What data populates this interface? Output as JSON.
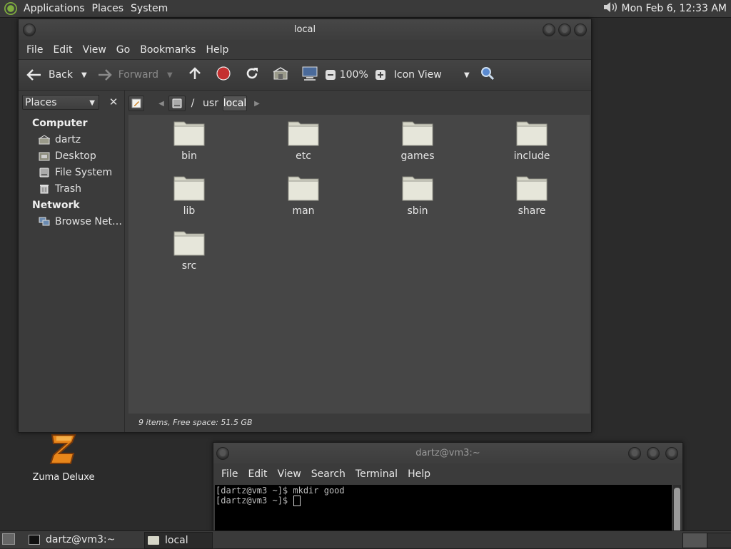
{
  "top_panel": {
    "menus": [
      "Applications",
      "Places",
      "System"
    ],
    "clock": "Mon Feb  6, 12:33 AM"
  },
  "file_manager": {
    "title": "local",
    "menu": [
      "File",
      "Edit",
      "View",
      "Go",
      "Bookmarks",
      "Help"
    ],
    "toolbar": {
      "back": "Back",
      "forward": "Forward",
      "zoom": "100%",
      "view_mode": "Icon View"
    },
    "sidebar": {
      "select": "Places",
      "sections": [
        {
          "heading": "Computer",
          "items": [
            {
              "label": "dartz",
              "icon": "home-icon"
            },
            {
              "label": "Desktop",
              "icon": "desktop-icon"
            },
            {
              "label": "File System",
              "icon": "drive-icon"
            },
            {
              "label": "Trash",
              "icon": "trash-icon"
            }
          ]
        },
        {
          "heading": "Network",
          "items": [
            {
              "label": "Browse Net…",
              "icon": "network-icon"
            }
          ]
        }
      ]
    },
    "path": [
      "/",
      "usr",
      "local"
    ],
    "folders": [
      "bin",
      "etc",
      "games",
      "include",
      "lib",
      "man",
      "sbin",
      "share",
      "src"
    ],
    "status": "9 items, Free space: 51.5 GB"
  },
  "terminal": {
    "title": "dartz@vm3:~",
    "menu": [
      "File",
      "Edit",
      "View",
      "Search",
      "Terminal",
      "Help"
    ],
    "lines": [
      "[dartz@vm3 ~]$ mkdir good",
      "[dartz@vm3 ~]$ "
    ]
  },
  "desktop": {
    "icon_label": "Zuma Deluxe"
  },
  "taskbar": {
    "tasks": [
      "dartz@vm3:~",
      "local"
    ]
  },
  "colors": {
    "folder": "#d6d6c8",
    "stop": "#c43030"
  }
}
